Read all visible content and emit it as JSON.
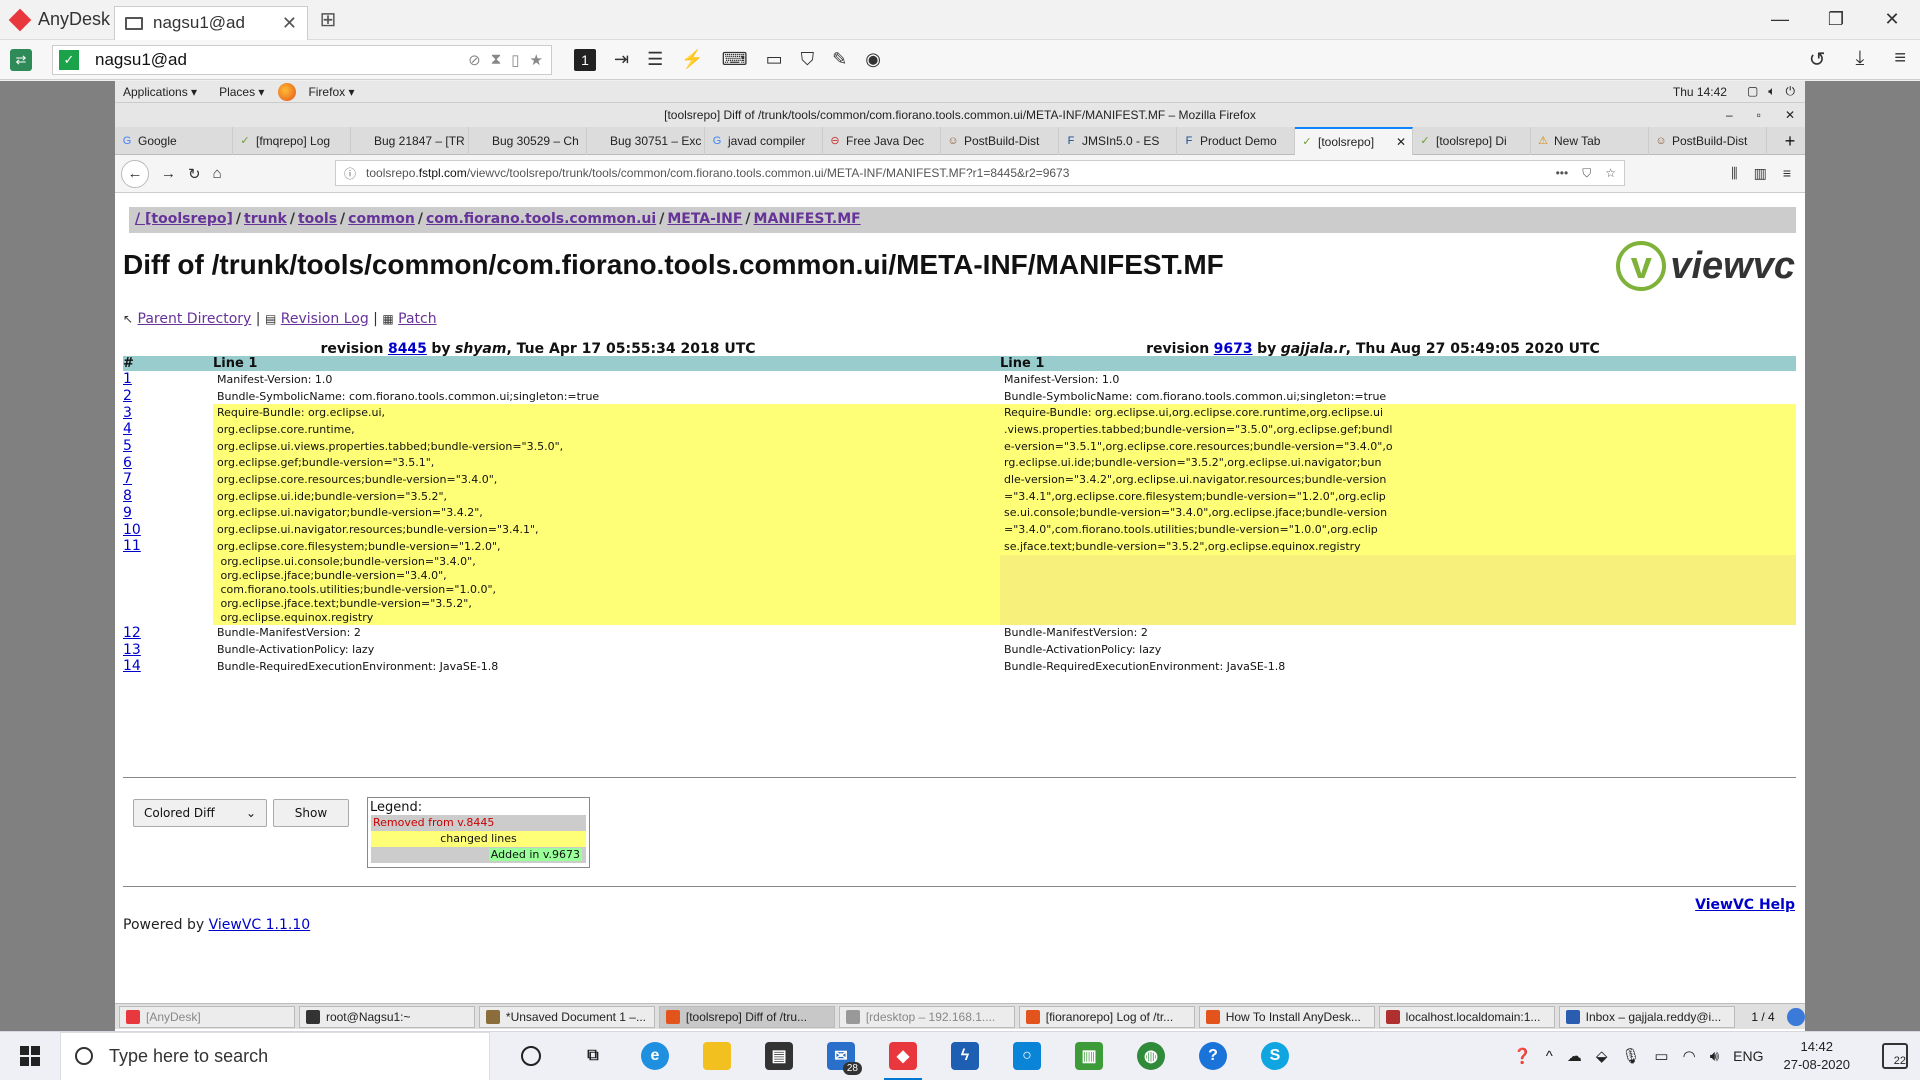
{
  "anydesk": {
    "app_name": "AnyDesk",
    "tab_label": "nagsu1@ad",
    "address_value": "nagsu1@ad",
    "display_number": "1",
    "window_controls": {
      "minimize": "—",
      "restore": "❐",
      "close": "✕"
    }
  },
  "gnome": {
    "applications": "Applications ▾",
    "places": "Places ▾",
    "firefox": "Firefox ▾",
    "clock": "Thu 14:42"
  },
  "firefox": {
    "window_title": "[toolsrepo] Diff of /trunk/tools/common/com.fiorano.tools.common.ui/META-INF/MANIFEST.MF – Mozilla Firefox",
    "tabs": [
      {
        "label": "Google",
        "icon": "G",
        "color": "#4285f4"
      },
      {
        "label": "[fmqrepo] Log",
        "icon": "✓",
        "color": "#6a9f2e"
      },
      {
        "label": "Bug 21847 – [TR",
        "icon": "",
        "color": "#888"
      },
      {
        "label": "Bug 30529 – Ch",
        "icon": "",
        "color": "#888"
      },
      {
        "label": "Bug 30751 – Exc",
        "icon": "",
        "color": "#888"
      },
      {
        "label": "javad compiler",
        "icon": "G",
        "color": "#4285f4"
      },
      {
        "label": "Free Java Dec",
        "icon": "⊖",
        "color": "#cc3333"
      },
      {
        "label": "PostBuild-Dist",
        "icon": "☺",
        "color": "#8b5a2b"
      },
      {
        "label": "JMSIn5.0 - ES",
        "icon": "F",
        "color": "#1a4d8f"
      },
      {
        "label": "Product Demo",
        "icon": "F",
        "color": "#1a4d8f"
      },
      {
        "label": "[toolsrepo]",
        "icon": "✓",
        "color": "#6a9f2e",
        "active": true
      },
      {
        "label": "[toolsrepo] Di",
        "icon": "✓",
        "color": "#6a9f2e"
      },
      {
        "label": "New Tab",
        "icon": "⚠",
        "color": "#d48a00"
      },
      {
        "label": "PostBuild-Dist",
        "icon": "☺",
        "color": "#8b5a2b"
      }
    ],
    "url_prefix": "toolsrepo.",
    "url_domain": "fstpl.com",
    "url_rest": "/viewvc/toolsrepo/trunk/tools/common/com.fiorano.tools.common.ui/META-INF/MANIFEST.MF?r1=8445&r2=9673"
  },
  "page": {
    "breadcrumbs": [
      "/ [toolsrepo]",
      "trunk",
      "tools",
      "common",
      "com.fiorano.tools.common.ui",
      "META-INF",
      "MANIFEST.MF"
    ],
    "title": "Diff of /trunk/tools/common/com.fiorano.tools.common.ui/META-INF/MANIFEST.MF",
    "logo_text": "viewvc",
    "links": {
      "parent": "Parent Directory",
      "revlog": "Revision Log",
      "patch": "Patch"
    },
    "rev_left": {
      "prefix": "revision",
      "num": "8445",
      "by": "by",
      "author": "shyam",
      "date": ", Tue Apr 17 05:55:34 2018 UTC"
    },
    "rev_right": {
      "prefix": "revision",
      "num": "9673",
      "by": "by",
      "author": "gajjala.r",
      "date": ", Thu Aug 27 05:49:05 2020 UTC"
    },
    "header": {
      "hash": "#",
      "left": "Line 1",
      "right": "Line 1"
    },
    "rows_before": [
      {
        "n": "1",
        "l": "Manifest-Version: 1.0",
        "r": "Manifest-Version: 1.0"
      },
      {
        "n": "2",
        "l": "Bundle-SymbolicName: com.fiorano.tools.common.ui;singleton:=true",
        "r": "Bundle-SymbolicName: com.fiorano.tools.common.ui;singleton:=true"
      }
    ],
    "rows_changed": [
      {
        "n": "3",
        "l": "Require-Bundle: org.eclipse.ui,",
        "r": "Require-Bundle: org.eclipse.ui,org.eclipse.core.runtime,org.eclipse.ui"
      },
      {
        "n": "4",
        "l": " org.eclipse.core.runtime,",
        "r": " .views.properties.tabbed;bundle-version=\"3.5.0\",org.eclipse.gef;bundl"
      },
      {
        "n": "5",
        "l": " org.eclipse.ui.views.properties.tabbed;bundle-version=\"3.5.0\",",
        "r": " e-version=\"3.5.1\",org.eclipse.core.resources;bundle-version=\"3.4.0\",o"
      },
      {
        "n": "6",
        "l": " org.eclipse.gef;bundle-version=\"3.5.1\",",
        "r": " rg.eclipse.ui.ide;bundle-version=\"3.5.2\",org.eclipse.ui.navigator;bun"
      },
      {
        "n": "7",
        "l": " org.eclipse.core.resources;bundle-version=\"3.4.0\",",
        "r": " dle-version=\"3.4.2\",org.eclipse.ui.navigator.resources;bundle-version"
      },
      {
        "n": "8",
        "l": " org.eclipse.ui.ide;bundle-version=\"3.5.2\",",
        "r": " =\"3.4.1\",org.eclipse.core.filesystem;bundle-version=\"1.2.0\",org.eclip"
      },
      {
        "n": "9",
        "l": " org.eclipse.ui.navigator;bundle-version=\"3.4.2\",",
        "r": " se.ui.console;bundle-version=\"3.4.0\",org.eclipse.jface;bundle-version"
      },
      {
        "n": "10",
        "l": " org.eclipse.ui.navigator.resources;bundle-version=\"3.4.1\",",
        "r": " =\"3.4.0\",com.fiorano.tools.utilities;bundle-version=\"1.0.0\",org.eclip"
      },
      {
        "n": "11",
        "l": " org.eclipse.core.filesystem;bundle-version=\"1.2.0\",",
        "r": " se.jface.text;bundle-version=\"3.5.2\",org.eclipse.equinox.registry"
      }
    ],
    "tail_lines": [
      " org.eclipse.ui.console;bundle-version=\"3.4.0\",",
      " org.eclipse.jface;bundle-version=\"3.4.0\",",
      " com.fiorano.tools.utilities;bundle-version=\"1.0.0\",",
      " org.eclipse.jface.text;bundle-version=\"3.5.2\",",
      " org.eclipse.equinox.registry"
    ],
    "rows_after": [
      {
        "n": "12",
        "l": "Bundle-ManifestVersion: 2",
        "r": "Bundle-ManifestVersion: 2"
      },
      {
        "n": "13",
        "l": "Bundle-ActivationPolicy: lazy",
        "r": "Bundle-ActivationPolicy: lazy"
      },
      {
        "n": "14",
        "l": "Bundle-RequiredExecutionEnvironment: JavaSE-1.8",
        "r": "Bundle-RequiredExecutionEnvironment: JavaSE-1.8"
      }
    ],
    "diff_type": "Colored Diff",
    "show_button": "Show",
    "legend": {
      "title": "Legend:",
      "removed": "Removed from v.8445",
      "changed": "changed lines",
      "added": "Added in v.9673"
    },
    "help": "ViewVC Help",
    "powered_prefix": "Powered by ",
    "powered_link": "ViewVC 1.1.10"
  },
  "remote_taskbar": {
    "tasks": [
      {
        "label": "[AnyDesk]",
        "color": "#e8383d",
        "dim": true
      },
      {
        "label": "root@Nagsu1:~",
        "color": "#333",
        "dim": false
      },
      {
        "label": "*Unsaved Document 1 –...",
        "color": "#8a6d3b",
        "dim": false
      },
      {
        "label": "[toolsrepo] Diff of /tru...",
        "color": "#e2541c",
        "dim": false,
        "active": true
      },
      {
        "label": "[rdesktop – 192.168.1....",
        "color": "#999",
        "dim": true
      },
      {
        "label": "[fioranorepo] Log of /tr...",
        "color": "#e2541c",
        "dim": false
      },
      {
        "label": "How To Install AnyDesk...",
        "color": "#e2541c",
        "dim": false
      },
      {
        "label": "localhost.localdomain:1...",
        "color": "#b03030",
        "dim": false
      },
      {
        "label": "Inbox – gajjala.reddy@i...",
        "color": "#2a5db0",
        "dim": false
      }
    ],
    "pager": "1 / 4"
  },
  "windows": {
    "search_placeholder": "Type here to search",
    "mail_badge": "28",
    "language": "ENG",
    "time": "14:42",
    "date": "27-08-2020",
    "notifications": "22"
  }
}
